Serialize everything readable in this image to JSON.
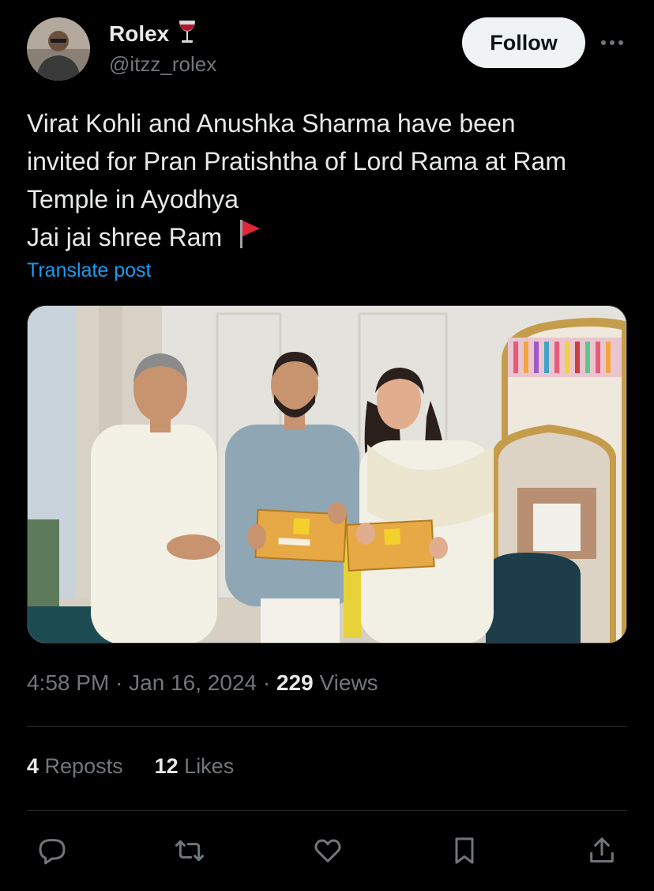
{
  "author": {
    "display_name": "Rolex",
    "name_emoji_icon": "wine-glass-icon",
    "handle": "@itzz_rolex",
    "avatar_icon": "user-avatar"
  },
  "header": {
    "follow_label": "Follow",
    "more_icon": "more-horizontal-icon"
  },
  "post": {
    "lines": [
      "Virat Kohli and Anushka Sharma have been",
      "invited for Pran Pratishtha of Lord Rama at Ram",
      "Temple in Ayodhya",
      "Jai jai shree Ram"
    ],
    "trailing_emoji_icon": "red-flag-icon",
    "translate_label": "Translate post"
  },
  "meta": {
    "time": "4:58 PM",
    "separator": "·",
    "date": "Jan 16, 2024",
    "views_count": "229",
    "views_label": "Views"
  },
  "stats": {
    "reposts_count": "4",
    "reposts_label": "Reposts",
    "likes_count": "12",
    "likes_label": "Likes"
  },
  "actions": [
    "reply-icon",
    "repost-icon",
    "like-icon",
    "bookmark-icon",
    "share-icon"
  ],
  "colors": {
    "background": "#000000",
    "text": "#e7e9ea",
    "secondary_text": "#71767b",
    "link": "#1d9bf0",
    "follow_bg": "#eff3f4",
    "divider": "#2f3336"
  }
}
